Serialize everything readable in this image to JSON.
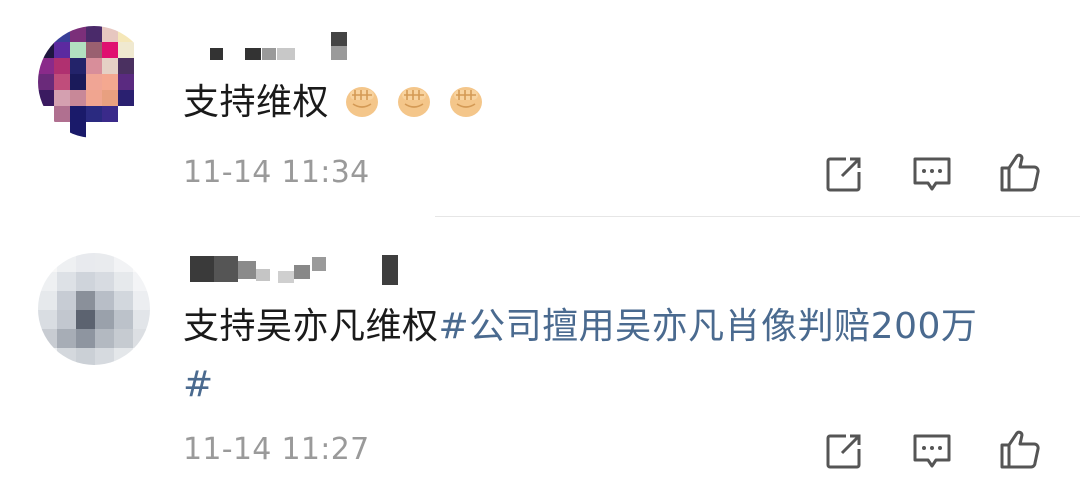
{
  "comments": [
    {
      "text": "支持维权",
      "emoji": [
        "fist",
        "fist",
        "fist"
      ],
      "timestamp": "11-14 11:34"
    },
    {
      "text": "支持吴亦凡维权",
      "hashtag_line1": "#公司擅用吴亦凡肖像判赔200万",
      "hashtag_line2": "#",
      "timestamp": "11-14 11:27"
    }
  ],
  "icons": {
    "share": "share-icon",
    "reply": "comment-icon",
    "like": "thumbs-up-icon"
  },
  "colors": {
    "text": "#1a1a1a",
    "hashtag": "#4a6a8f",
    "timestamp": "#9a9a9a",
    "icon": "#555555"
  }
}
